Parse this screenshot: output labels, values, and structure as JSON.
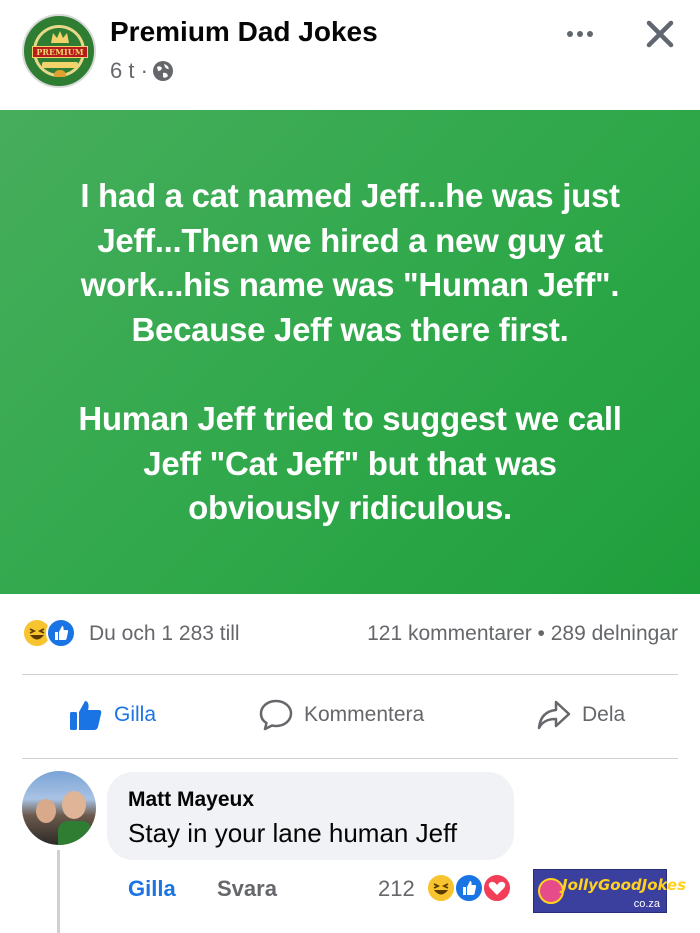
{
  "header": {
    "page_name": "Premium Dad Jokes",
    "time": "6 t ·",
    "avatar_text": "PREMIUM",
    "privacy_icon": "globe-icon",
    "more_icon": "more-horizontal-icon",
    "close_icon": "close-icon"
  },
  "post": {
    "text": "I had a cat named Jeff...he was just\nJeff...Then we hired a new guy at\nwork...his name was \"Human Jeff\".\nBecause Jeff was there first.\n\nHuman Jeff tried to suggest we call\nJeff \"Cat Jeff\" but that was\nobviously ridiculous.",
    "background_color": "#2fa84a"
  },
  "summary": {
    "reactions_text": "Du och 1 283 till",
    "counts_text": "121 kommentarer • 289 delningar",
    "reaction_icons": [
      "haha-icon",
      "like-icon"
    ]
  },
  "actions": {
    "like_label": "Gilla",
    "comment_label": "Kommentera",
    "share_label": "Dela"
  },
  "comment": {
    "author": "Matt Mayeux",
    "text": "Stay in your lane human Jeff",
    "like_label": "Gilla",
    "reply_label": "Svara",
    "reaction_count": "212",
    "reaction_icons": [
      "haha-icon",
      "like-icon",
      "love-icon"
    ]
  },
  "watermark": {
    "logo_text": "JollyGoodJokes",
    "domain": "co.za"
  },
  "colors": {
    "accent_blue": "#1b74e4",
    "muted_text": "#65676b",
    "post_green": "#2fa84a"
  }
}
